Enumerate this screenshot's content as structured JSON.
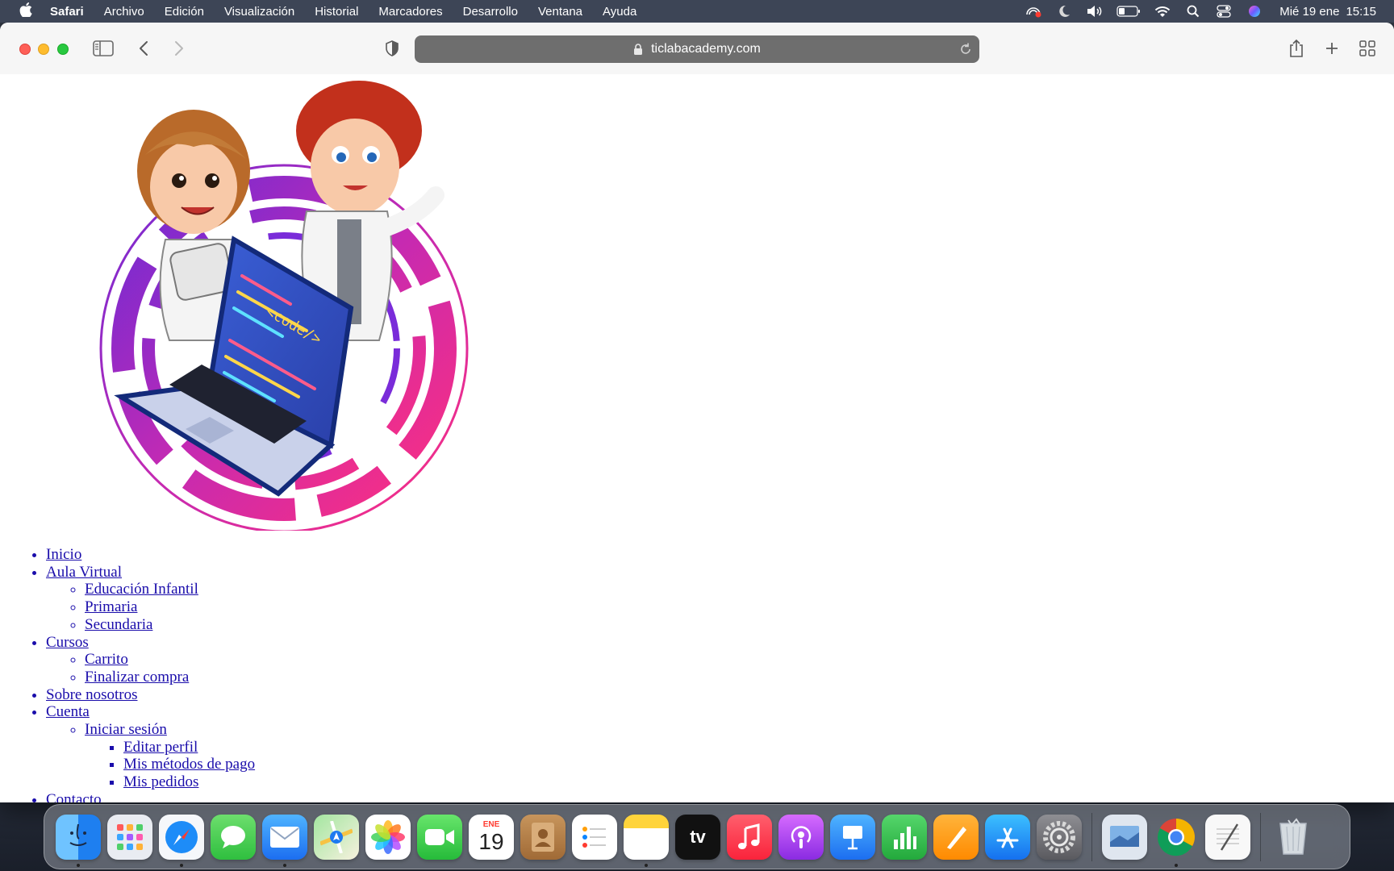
{
  "menubar": {
    "app_name": "Safari",
    "items": [
      "Archivo",
      "Edición",
      "Visualización",
      "Historial",
      "Marcadores",
      "Desarrollo",
      "Ventana",
      "Ayuda"
    ],
    "date": "Mié 19 ene",
    "time": "15:15"
  },
  "browser": {
    "url": "ticlabacademy.com"
  },
  "nav": {
    "inicio": "Inicio",
    "aula_virtual": "Aula Virtual",
    "educacion_infantil": "Educación Infantil",
    "primaria": "Primaria",
    "secundaria": "Secundaria",
    "cursos": "Cursos",
    "carrito": "Carrito",
    "finalizar_compra": "Finalizar compra",
    "sobre_nosotros": "Sobre nosotros",
    "cuenta": "Cuenta",
    "iniciar_sesion": "Iniciar sesión",
    "editar_perfil": "Editar perfil",
    "mis_metodos_pago": "Mis métodos de pago",
    "mis_pedidos": "Mis pedidos",
    "contacto": "Contacto"
  },
  "hero": {
    "laptop_text": "<code/>"
  },
  "dock": {
    "calendar_month": "ENE",
    "calendar_day": "19",
    "tv_label": "tv",
    "apps": [
      "finder",
      "launchpad",
      "safari",
      "messages",
      "mail",
      "maps",
      "photos",
      "facetime",
      "calendar",
      "contacts",
      "reminders",
      "notes",
      "apple-tv",
      "music",
      "podcasts",
      "keynote",
      "numbers",
      "pages",
      "app-store",
      "system-preferences",
      "preview",
      "chrome",
      "textedit",
      "trash"
    ]
  }
}
